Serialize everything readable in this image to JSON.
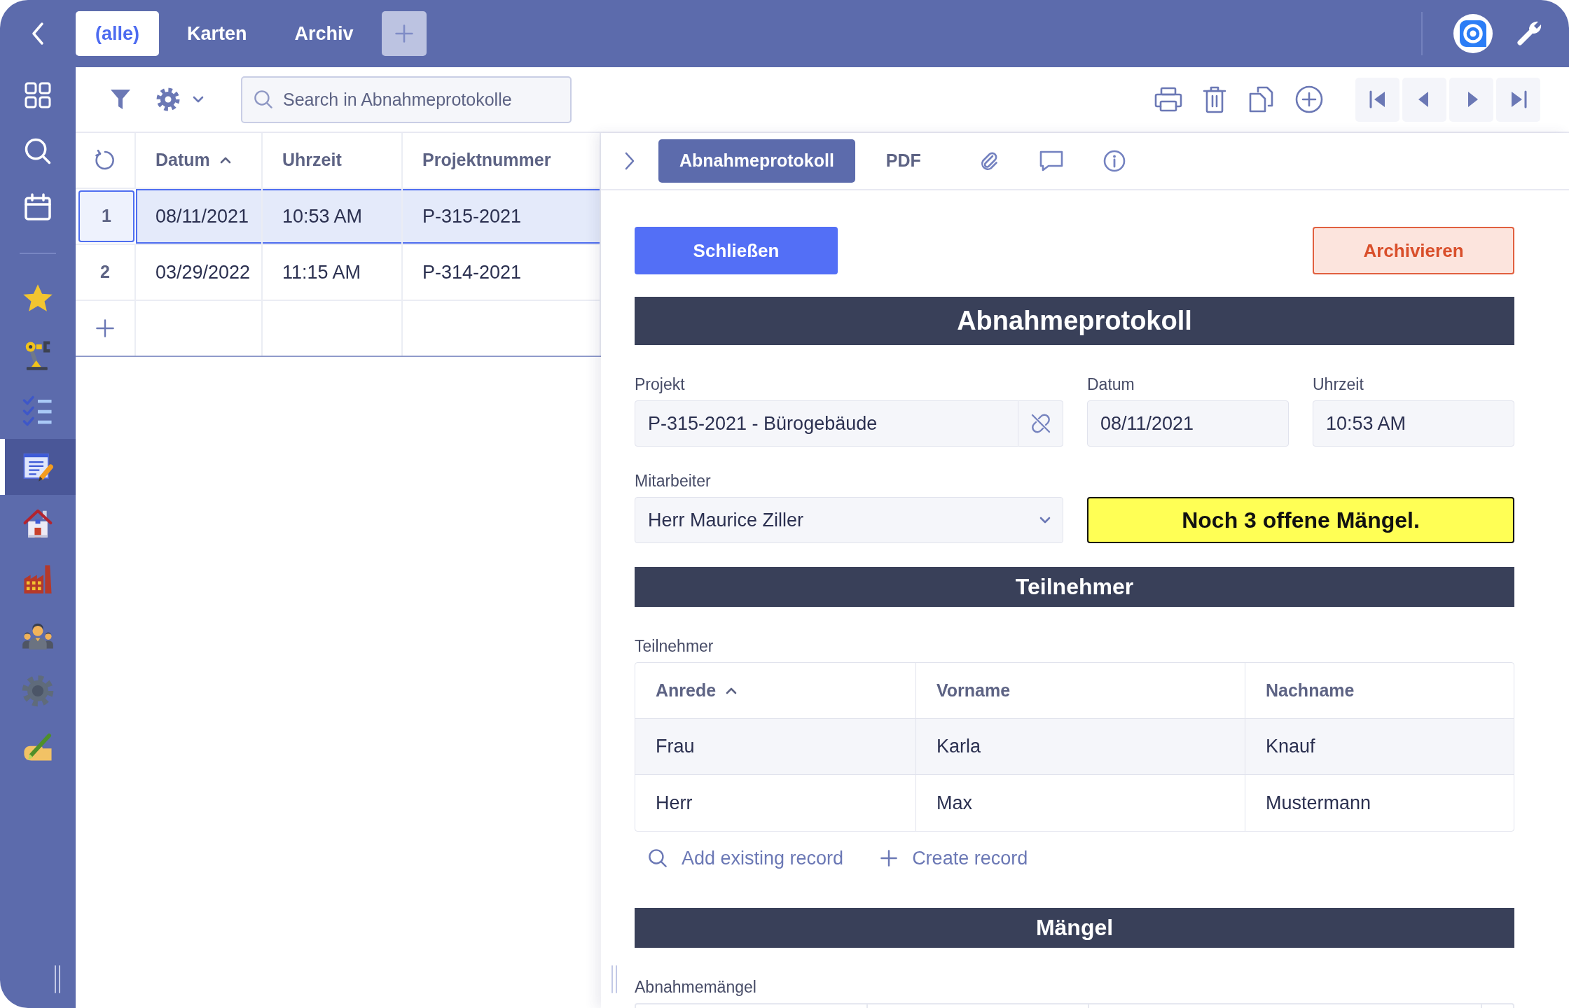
{
  "top_bar": {
    "tabs": [
      {
        "label": "(alle)",
        "selected": true
      },
      {
        "label": "Karten",
        "selected": false
      },
      {
        "label": "Archiv",
        "selected": false
      }
    ]
  },
  "sidebar": {
    "modules": [
      {
        "selected": false
      },
      {
        "selected": false
      },
      {
        "selected": false
      },
      {
        "selected": true
      },
      {
        "selected": false
      },
      {
        "selected": false
      },
      {
        "selected": false
      },
      {
        "selected": false
      },
      {
        "selected": false
      }
    ]
  },
  "toolbar": {
    "search": {
      "placeholder": "Search in Abnahmeprotokolle"
    }
  },
  "list": {
    "columns": [
      {
        "label": "Datum",
        "sorted": true
      },
      {
        "label": "Uhrzeit",
        "sorted": false
      },
      {
        "label": "Projektnummer",
        "sorted": false
      }
    ],
    "rows": [
      {
        "number": "1",
        "cells": [
          "08/11/2021",
          "10:53 AM",
          "P-315-2021"
        ],
        "selected": true
      },
      {
        "number": "2",
        "cells": [
          "03/29/2022",
          "11:15 AM",
          "P-314-2021"
        ],
        "selected": false
      }
    ]
  },
  "detail": {
    "tabs": [
      {
        "label": "Abnahmeprotokoll",
        "selected": true
      },
      {
        "label": "PDF",
        "selected": false
      }
    ],
    "icon_tabs": [
      {
        "selected": false
      },
      {
        "selected": false
      },
      {
        "selected": false
      }
    ],
    "buttons": {
      "close": "Schließen",
      "archive": "Archivieren"
    },
    "form": {
      "title": "Abnahmeprotokoll",
      "fields": [
        {
          "kind": "lookup",
          "label": "Projekt",
          "value": "P-315-2021 - Bürogebäude"
        },
        {
          "kind": "date",
          "label": "Datum",
          "value": "08/11/2021"
        },
        {
          "kind": "time",
          "label": "Uhrzeit",
          "value": "10:53 AM"
        },
        {
          "kind": "select",
          "label": "Mitarbeiter",
          "value": "Herr Maurice Ziller"
        }
      ],
      "notice": "Noch 3 offene Mängel."
    },
    "participants": {
      "title": "Teilnehmer",
      "label": "Teilnehmer",
      "columns": [
        {
          "label": "Anrede",
          "sorted": true
        },
        {
          "label": "Vorname",
          "sorted": false
        },
        {
          "label": "Nachname",
          "sorted": false
        }
      ],
      "rows": [
        {
          "cells": [
            "Frau",
            "Karla",
            "Knauf"
          ]
        },
        {
          "cells": [
            "Herr",
            "Max",
            "Mustermann"
          ]
        }
      ],
      "actions": [
        {
          "kind": "add_existing",
          "label": "Add existing record"
        },
        {
          "kind": "create",
          "label": "Create record"
        }
      ]
    },
    "defects": {
      "title": "Mängel",
      "label": "Abnahmemängel"
    }
  }
}
